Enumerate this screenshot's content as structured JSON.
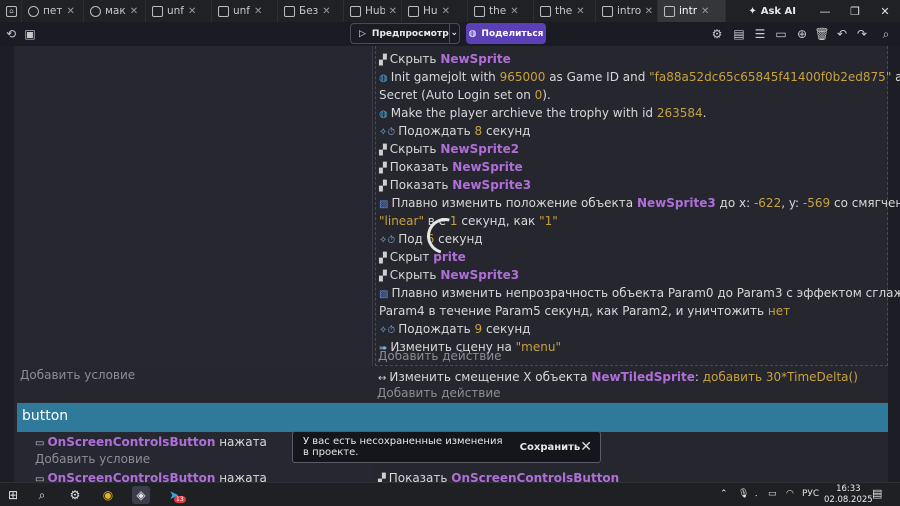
{
  "browser": {
    "tabs": [
      {
        "label": "пет",
        "icon": "github-icon"
      },
      {
        "label": "мак",
        "icon": "github-icon"
      },
      {
        "label": "unf",
        "icon": "bookmark-icon"
      },
      {
        "label": "unf",
        "icon": "layers-icon"
      },
      {
        "label": "Без",
        "icon": "layers-icon"
      },
      {
        "label": "Hub",
        "icon": "bookmark-icon"
      },
      {
        "label": "Hu",
        "icon": "layers-icon"
      },
      {
        "label": "the",
        "icon": "bookmark-icon"
      },
      {
        "label": "the",
        "icon": "layers-icon"
      },
      {
        "label": "intro",
        "icon": "bookmark-icon"
      },
      {
        "label": "intr",
        "icon": "bookmark-icon",
        "active": true
      }
    ],
    "ask_ai": "Ask AI"
  },
  "toolbar": {
    "preview_label": "Предпросмотр",
    "share_label": "Поделиться"
  },
  "events": {
    "actions": [
      {
        "parts": [
          [
            "t",
            "Скрыть "
          ],
          [
            "o",
            "NewSprite"
          ]
        ],
        "icon": "hide-icon"
      },
      {
        "parts": [
          [
            "t",
            "Init gamejolt with "
          ],
          [
            "n",
            "965000"
          ],
          [
            "t",
            " as Game ID and "
          ],
          [
            "s",
            "\"fa88a52dc65c65845f41400f0b2ed875\""
          ],
          [
            "t",
            " as Game"
          ]
        ],
        "icon": "gamejolt-icon"
      },
      {
        "parts": [
          [
            "t",
            "Secret (Auto Login set on "
          ],
          [
            "n",
            "0"
          ],
          [
            "t",
            ")."
          ]
        ],
        "icon": ""
      },
      {
        "parts": [
          [
            "t",
            "Make the player archieve the trophy with id "
          ],
          [
            "n",
            "263584"
          ],
          [
            "t",
            "."
          ]
        ],
        "icon": "gamejolt-icon"
      },
      {
        "parts": [
          [
            "t",
            "Подождать "
          ],
          [
            "n",
            "8"
          ],
          [
            "t",
            " секунд"
          ]
        ],
        "icon": "timer-icon"
      },
      {
        "parts": [
          [
            "t",
            "Скрыть "
          ],
          [
            "o",
            "NewSprite2"
          ]
        ],
        "icon": "hide-icon"
      },
      {
        "parts": [
          [
            "t",
            "Показать "
          ],
          [
            "o",
            "NewSprite"
          ]
        ],
        "icon": "hide-icon"
      },
      {
        "parts": [
          [
            "t",
            "Показать "
          ],
          [
            "o",
            "NewSprite3"
          ]
        ],
        "icon": "hide-icon"
      },
      {
        "parts": [
          [
            "t",
            "Плавно изменить положение объекта "
          ],
          [
            "o",
            "NewSprite3"
          ],
          [
            "t",
            " до x: "
          ],
          [
            "n",
            "-622"
          ],
          [
            "t",
            ", y: "
          ],
          [
            "n",
            "-569"
          ],
          [
            "t",
            " со смягчением"
          ]
        ],
        "icon": "tween-icon"
      },
      {
        "parts": [
          [
            "s",
            "\"linear\""
          ],
          [
            "t",
            " в       е "
          ],
          [
            "n",
            "1"
          ],
          [
            "t",
            " секунд, как "
          ],
          [
            "s",
            "\"1\""
          ]
        ],
        "icon": ""
      },
      {
        "parts": [
          [
            "t",
            "Под          "
          ],
          [
            "n",
            "6"
          ],
          [
            "t",
            " секунд"
          ]
        ],
        "icon": "timer-icon"
      },
      {
        "parts": [
          [
            "t",
            "Скрыт          "
          ],
          [
            "o",
            "prite"
          ]
        ],
        "icon": "hide-icon"
      },
      {
        "parts": [
          [
            "t",
            "Скрыть "
          ],
          [
            "o",
            "NewSprite3"
          ]
        ],
        "icon": "hide-icon"
      },
      {
        "parts": [
          [
            "t",
            "Плавно изменить непрозрачность объекта Param0 до Param3 с эффектом сглаживания"
          ]
        ],
        "icon": "tween-icon"
      },
      {
        "parts": [
          [
            "t",
            "Param4 в течение Param5 секунд, как Param2, и уничтожить "
          ],
          [
            "k",
            "нет"
          ]
        ],
        "icon": ""
      },
      {
        "parts": [
          [
            "t",
            "Подождать "
          ],
          [
            "n",
            "9"
          ],
          [
            "t",
            " секунд"
          ]
        ],
        "icon": "timer-icon"
      },
      {
        "parts": [
          [
            "t",
            "Изменить сцену на "
          ],
          [
            "s",
            "\"menu\""
          ]
        ],
        "icon": "scene-icon"
      }
    ],
    "add_action": "Добавить действие",
    "add_condition": "Добавить условие",
    "action2": {
      "parts": [
        [
          "t",
          "Изменить смещение X объекта "
        ],
        [
          "o",
          "NewTiledSprite"
        ],
        [
          "t",
          ": "
        ],
        [
          "k",
          "добавить"
        ],
        [
          "t",
          " "
        ],
        [
          "n",
          "30*TimeDelta()"
        ]
      ],
      "icon": "offset-icon"
    },
    "group_title": "button",
    "condition2": {
      "parts": [
        [
          "o",
          "OnScreenControlsButton"
        ],
        [
          "t",
          " нажата"
        ]
      ],
      "icon": "gamepad-icon"
    },
    "condition3": {
      "parts": [
        [
          "o",
          "OnScreenControlsButton"
        ],
        [
          "t",
          " нажата"
        ]
      ],
      "icon": "gamepad-icon"
    },
    "action3": {
      "parts": [
        [
          "t",
          "Показать "
        ],
        [
          "o",
          "OnScreenControlsButton"
        ]
      ],
      "icon": "hide-icon"
    }
  },
  "toast": {
    "message": "У вас есть несохраненные изменения в проекте.",
    "save_label": "Сохранить"
  },
  "taskbar": {
    "lang": "РУС",
    "time": "16:33",
    "date": "02.08.2025",
    "telegram_badge": "13"
  },
  "colors": {
    "object": "#b06fd8",
    "value": "#c8a23e",
    "accent": "#5a3fb5",
    "group": "#2f7a9a"
  }
}
